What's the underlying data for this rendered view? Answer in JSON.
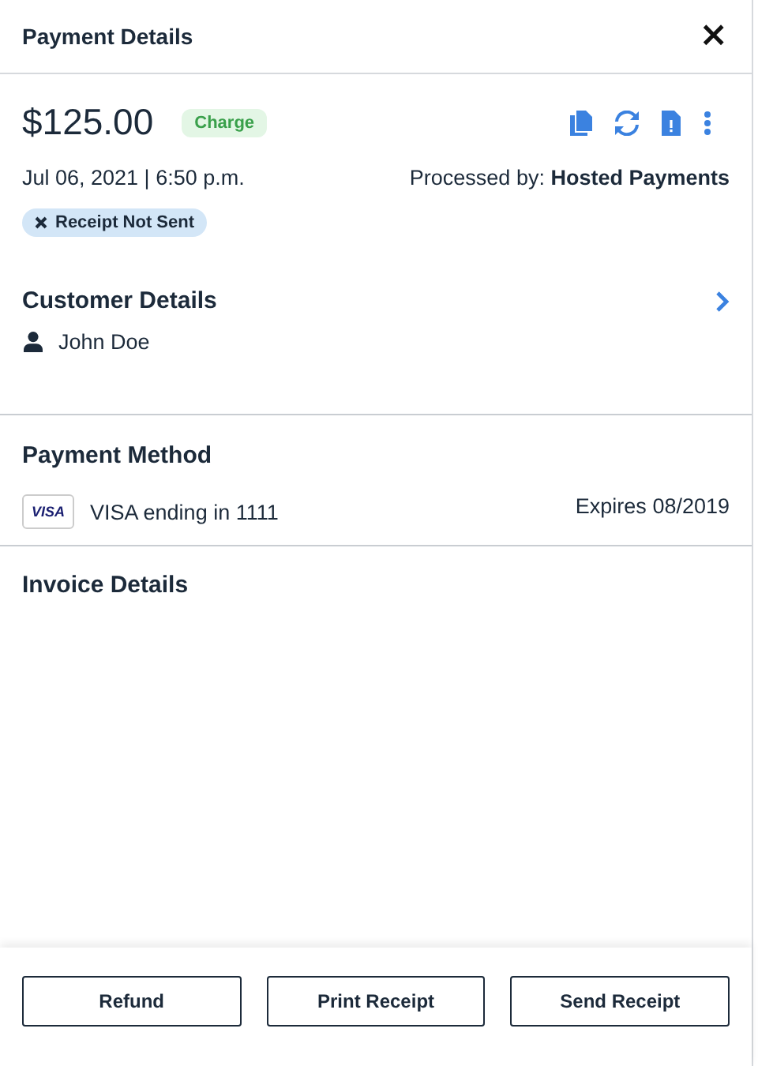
{
  "panel": {
    "title": "Payment Details",
    "close": "×"
  },
  "summary": {
    "amount": "$125.00",
    "type_tag": "Charge",
    "date": "Jul 06, 2021 | 6:50 p.m.",
    "processed_by": "Processed by: **Hosted Payments**",
    "receipt_status": "Receipt Not Sent"
  },
  "customer": {
    "heading": "Customer Details",
    "name": "John Doe"
  },
  "payment_method": {
    "heading": "Payment Method",
    "card_brand": "VISA",
    "card": "VISA ending in 1111",
    "expires": "Expires 08/2019"
  },
  "invoice": {
    "heading": "Invoice Details"
  },
  "buttons": [
    {
      "label": "Refund"
    },
    {
      "label": "Print Receipt"
    },
    {
      "label": "Send Receipt"
    }
  ]
}
